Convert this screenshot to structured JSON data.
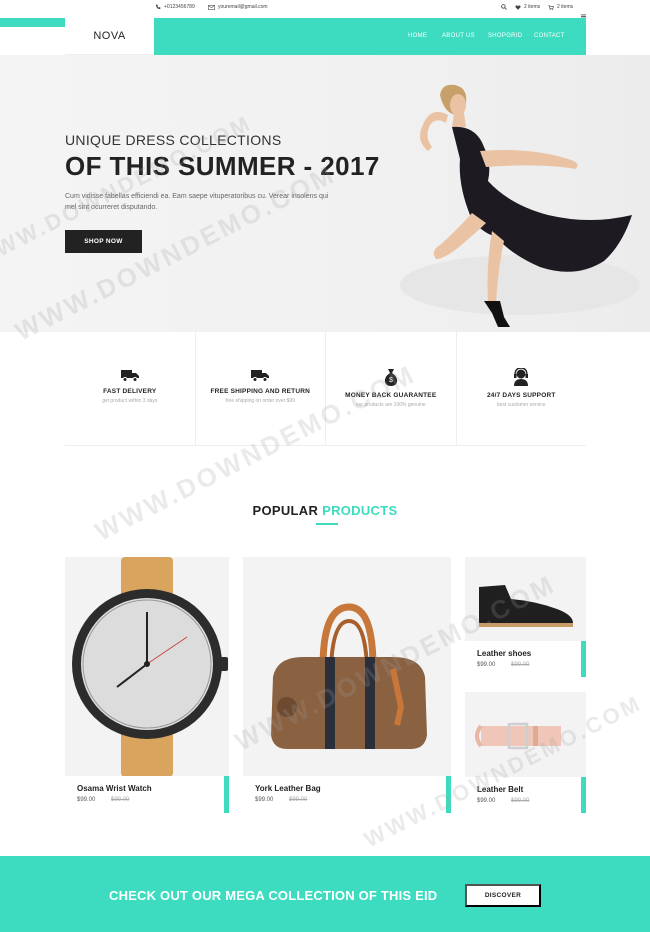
{
  "topbar": {
    "phone": "+0123456789",
    "email": "youremail@gmail.com",
    "wishlist": "2 items",
    "cart": "2 items"
  },
  "brand": {
    "logo": "NOVA"
  },
  "nav": {
    "items": [
      "HOME",
      "ABOUT US",
      "SHOPGRID",
      "CONTACT"
    ]
  },
  "hero": {
    "subtitle": "UNIQUE DRESS COLLECTIONS",
    "title": "OF THIS SUMMER - 2017",
    "text": "Cum vidisse fabellas efficiendi ea. Eam saepe vituperatoribus cu. Verear insolens qui mel sint ocurreret disputando.",
    "button": "SHOP NOW"
  },
  "features": [
    {
      "icon": "truck-icon",
      "title": "FAST DELIVERY",
      "sub": "get product within 3 days"
    },
    {
      "icon": "truck-icon",
      "title": "FREE SHIPPING AND RETURN",
      "sub": "free shipping on order over $99"
    },
    {
      "icon": "money-bag-icon",
      "title": "MONEY BACK GUARANTEE",
      "sub": "our products are 100% genuine"
    },
    {
      "icon": "support-agent-icon",
      "title": "24/7 DAYS SUPPORT",
      "sub": "best customer service"
    }
  ],
  "popular": {
    "title_a": "POPULAR",
    "title_b": "PRODUCTS"
  },
  "products": [
    {
      "name": "Osama Wrist Watch",
      "price": "$99.00",
      "old": "$99.00"
    },
    {
      "name": "York Leather Bag",
      "price": "$99.00",
      "old": "$99.00"
    },
    {
      "name": "Leather shoes",
      "price": "$99.00",
      "old": "$99.00"
    },
    {
      "name": "Leather Belt",
      "price": "$99.00",
      "old": "$99.00"
    }
  ],
  "banner": {
    "text": "CHECK OUT OUR MEGA COLLECTION OF THIS EID",
    "button": "DISCOVER"
  },
  "watermark": "WWW.DOWNDEMO.COM",
  "colors": {
    "accent": "#3ddcc0",
    "dark": "#222222"
  }
}
